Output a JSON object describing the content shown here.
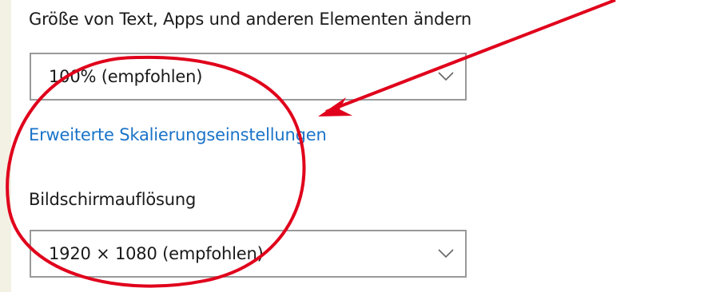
{
  "scaling": {
    "label": "Größe von Text, Apps und anderen Elementen ändern",
    "selected_value": "100% (empfohlen)"
  },
  "advanced_link": {
    "label": "Erweiterte Skalierungseinstellungen"
  },
  "resolution": {
    "label": "Bildschirmauflösung",
    "selected_value": "1920 × 1080 (empfohlen)"
  },
  "colors": {
    "link": "#1a73c8",
    "annotation": "#e0001b",
    "border": "#999999"
  },
  "icons": {
    "dropdown": "chevron-down-icon",
    "annotation_arrow": "arrow-annotation",
    "annotation_circle": "circle-annotation"
  }
}
